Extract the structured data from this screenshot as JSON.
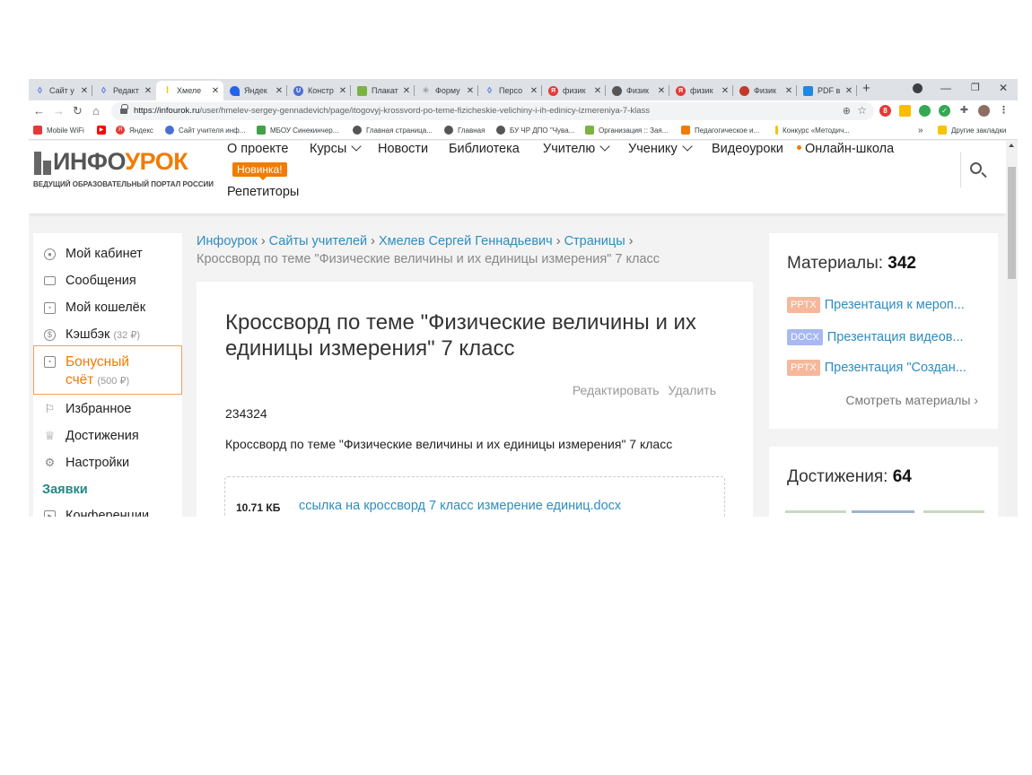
{
  "browser": {
    "tabs": [
      {
        "label": "Сайт у",
        "icon": "bookmark-diamond-icon",
        "color": "#4a6fd6"
      },
      {
        "label": "Редакт",
        "icon": "bookmark-diamond-icon",
        "color": "#4a6fd6"
      },
      {
        "label": "Хмеле",
        "icon": "infourok-icon",
        "color": "#f5c400"
      },
      {
        "label": "Яндек",
        "icon": "yandex-wave-icon",
        "color": "#2563eb"
      },
      {
        "label": "Констр",
        "icon": "u-icon",
        "color": "#4a6fd6"
      },
      {
        "label": "Плакат",
        "icon": "plakat-icon",
        "color": "#7cb342"
      },
      {
        "label": "Форму",
        "icon": "formula-icon",
        "color": "#888888"
      },
      {
        "label": "Персо",
        "icon": "bookmark-diamond-icon",
        "color": "#4a6fd6"
      },
      {
        "label": "физик",
        "icon": "yandex-icon",
        "color": "#e53935"
      },
      {
        "label": "Физик",
        "icon": "globe-icon",
        "color": "#555555"
      },
      {
        "label": "физик",
        "icon": "yandex-icon",
        "color": "#e53935"
      },
      {
        "label": "Физик",
        "icon": "face-icon",
        "color": "#c0392b"
      },
      {
        "label": "PDF в",
        "icon": "pdf-icon",
        "color": "#1e88e5"
      }
    ],
    "url_host": "https://infourok.ru",
    "url_path": "/user/hmelev-sergey-gennadevich/page/itogovyj-krossvord-po-teme-fizicheskie-velichiny-i-ih-edinicy-izmereniya-7-klass",
    "bookmarks": [
      {
        "label": "Mobile WiFi",
        "color": "#e53935"
      },
      {
        "label": "",
        "color": "#ff0000"
      },
      {
        "label": "Яндекс",
        "color": "#e53935"
      },
      {
        "label": "Сайт учителя инф...",
        "color": "#4a6fd6"
      },
      {
        "label": "МБОУ Синекинчер...",
        "color": "#43a047"
      },
      {
        "label": "Главная страница...",
        "color": "#555555"
      },
      {
        "label": "Главная",
        "color": "#555555"
      },
      {
        "label": "БУ ЧР ДПО \"Чува...",
        "color": "#555555"
      },
      {
        "label": "Организация :: Зая...",
        "color": "#7cb342"
      },
      {
        "label": "Педагогическое и...",
        "color": "#f07c00"
      },
      {
        "label": "Конкурс «Методич...",
        "color": "#f5c400"
      }
    ],
    "bookmarks_more": "»",
    "other_bookmarks": "Другие закладки"
  },
  "site": {
    "logo_prefix": "ИНФО",
    "logo_suffix": "УРОК",
    "tagline": "ВЕДУЩИЙ ОБРАЗОВАТЕЛЬНЫЙ ПОРТАЛ РОССИИ",
    "nav": {
      "about": "О проекте",
      "courses": "Курсы",
      "news": "Новости",
      "library": "Библиотека",
      "teacher": "Учителю",
      "student": "Ученику",
      "video": "Видеоуроки",
      "online_school": "Онлайн-школа",
      "tutors": "Репетиторы"
    },
    "new_badge": "Новинка!"
  },
  "sidebar": {
    "cabinet": "Мой кабинет",
    "messages": "Сообщения",
    "wallet": "Мой кошелёк",
    "cashback": "Кэшбэк",
    "cashback_amount": "(32 ₽)",
    "bonus_line1": "Бонусный",
    "bonus_line2": "счёт",
    "bonus_amount": "(500 ₽)",
    "favorites": "Избранное",
    "achievements": "Достижения",
    "settings": "Настройки",
    "section_requests": "Заявки",
    "conferences": "Конференции"
  },
  "breadcrumb": {
    "home": "Инфоурок",
    "sites": "Сайты учителей",
    "author": "Хмелев Сергей Геннадьевич",
    "pages": "Страницы",
    "sep": "›",
    "current": "Кроссворд по теме \"Физические величины и их единицы измерения\" 7 класс"
  },
  "page": {
    "title": "Кроссворд по теме \"Физические величины и их единицы измерения\" 7 класс",
    "edit": "Редактировать",
    "delete": "Удалить",
    "code": "234324",
    "description": "Кроссворд по теме \"Физические величины и их единицы измерения\" 7 класс",
    "file_size": "10.71 КБ",
    "file_link": "ссылка на кроссворд 7 класс измерение единиц.docx"
  },
  "materials": {
    "label": "Материалы:",
    "count": "342",
    "items": [
      {
        "tag": "PPTX",
        "tag_color": "#f7b79a",
        "title": "Презентация к мероп..."
      },
      {
        "tag": "DOCX",
        "tag_color": "#a8b8f0",
        "title": "Презентация видеов..."
      },
      {
        "tag": "PPTX",
        "tag_color": "#f7b79a",
        "title": "Презентация \"Создан..."
      }
    ],
    "more": "Смотреть материалы ›"
  },
  "achievements_card": {
    "label": "Достижения:",
    "count": "64"
  },
  "colors": {
    "accent": "#f07c00",
    "link": "#2d8dbf",
    "section": "#1f8a86"
  }
}
